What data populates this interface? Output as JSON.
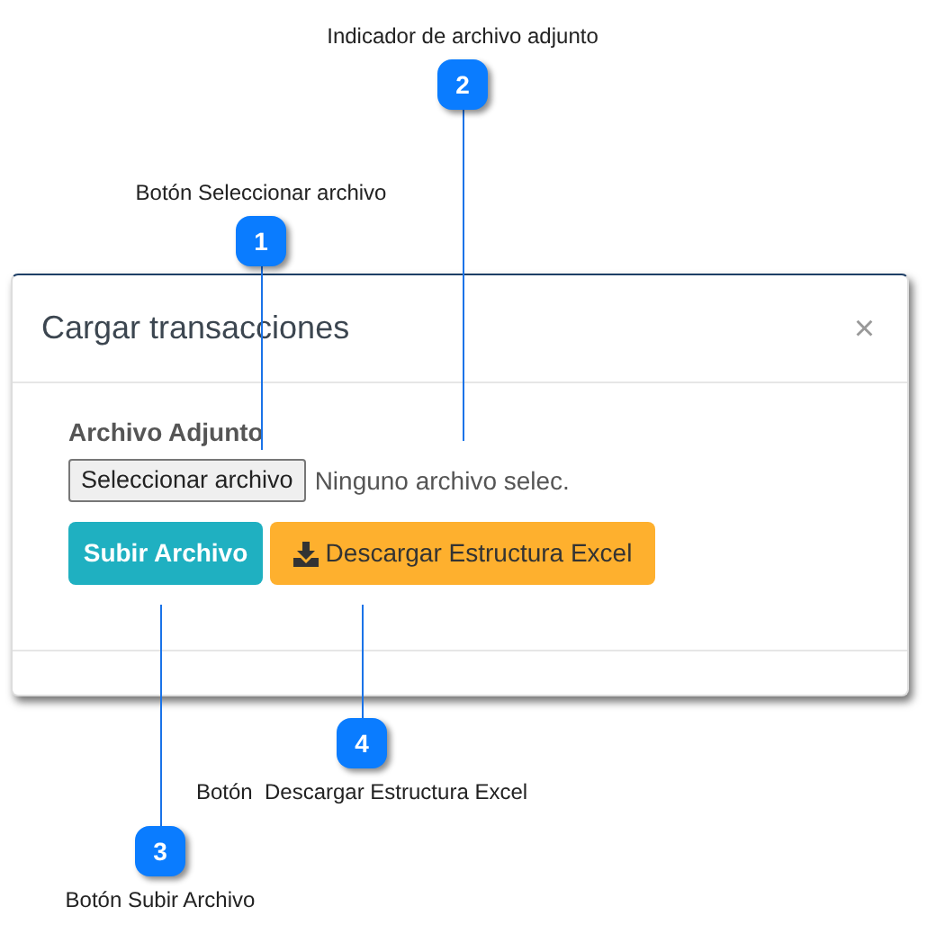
{
  "dialog": {
    "title": "Cargar transacciones",
    "close": "×",
    "field_label": "Archivo Adjunto",
    "file_button": "Seleccionar archivo",
    "file_status": "Ninguno archivo selec.",
    "buttons": [
      {
        "kind": "primary",
        "label": "Subir Archivo"
      },
      {
        "kind": "download",
        "label": "Descargar Estructura Excel"
      }
    ]
  },
  "callouts": [
    {
      "number": "1",
      "label": "Botón Seleccionar archivo"
    },
    {
      "number": "2",
      "label": "Indicador de archivo adjunto"
    },
    {
      "number": "3",
      "label": "Botón Subir Archivo"
    },
    {
      "number": "4",
      "label": "Botón  Descargar Estructura Excel"
    }
  ]
}
